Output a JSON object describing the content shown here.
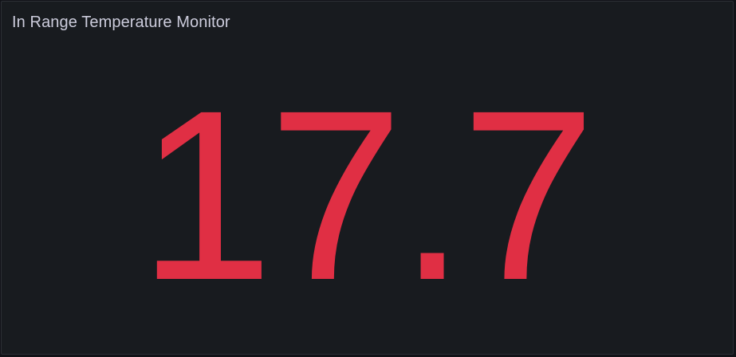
{
  "panel": {
    "title": "In Range Temperature Monitor",
    "stat": {
      "value": "17.7",
      "color": "#e02f44"
    }
  },
  "colors": {
    "background": "#181b1f",
    "border": "#2c2f36",
    "title_text": "#ccccdc"
  }
}
